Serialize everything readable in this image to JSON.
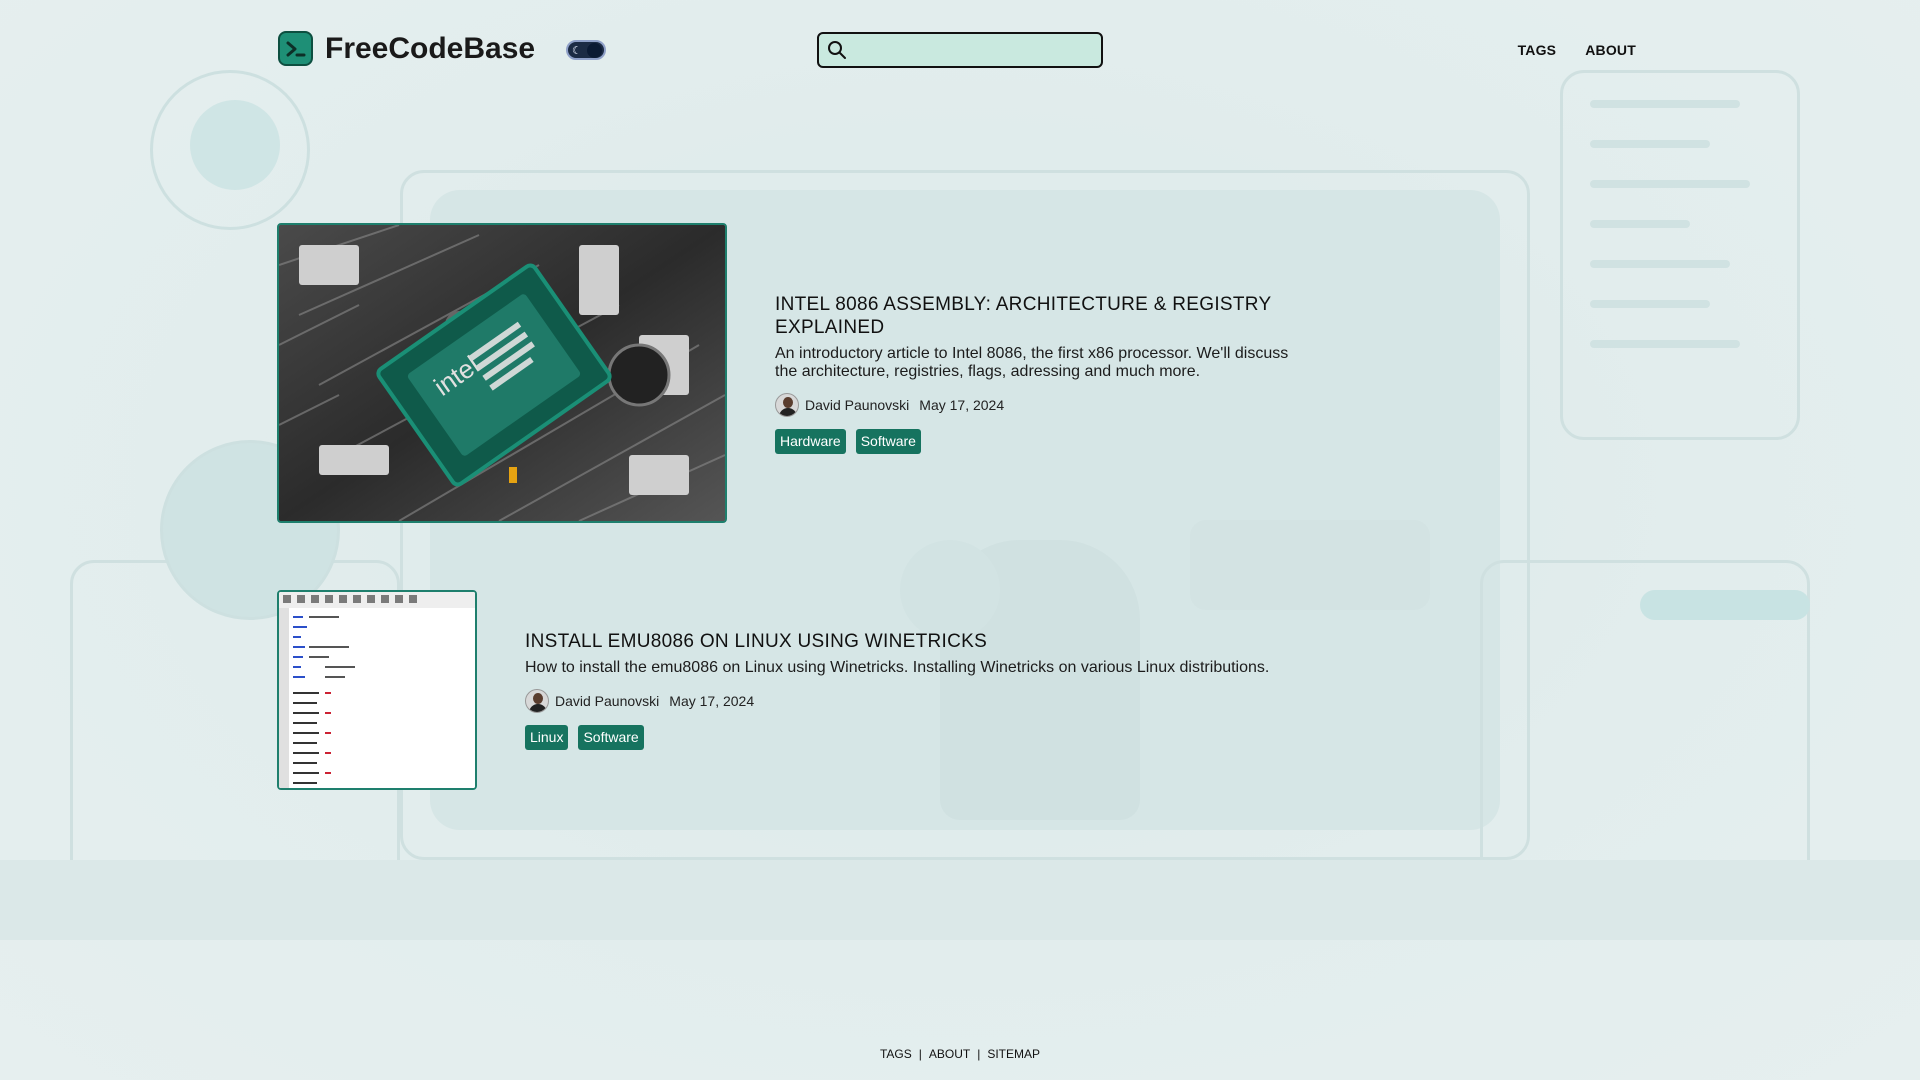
{
  "header": {
    "brand": "FreeCodeBase",
    "search_placeholder": "",
    "nav": [
      "TAGS",
      "ABOUT"
    ]
  },
  "posts": [
    {
      "title": "INTEL 8086 ASSEMBLY: ARCHITECTURE & REGISTRY EXPLAINED",
      "description": "An introductory article to Intel 8086, the first x86 processor. We'll discuss the architecture, registries, flags, adressing and much more.",
      "author": "David Paunovski",
      "date": "May 17, 2024",
      "tags": [
        "Hardware",
        "Software"
      ],
      "thumbnail_label": "intel"
    },
    {
      "title": "INSTALL EMU8086 ON LINUX USING WINETRICKS",
      "description": "How to install the emu8086 on Linux using Winetricks. Installing Winetricks on various Linux distributions.",
      "author": "David Paunovski",
      "date": "May 17, 2024",
      "tags": [
        "Linux",
        "Software"
      ]
    }
  ],
  "footer": {
    "links": [
      "TAGS",
      "ABOUT",
      "SITEMAP"
    ],
    "separator": "|"
  },
  "colors": {
    "accent": "#16735f",
    "background": "#e3eeee",
    "search_bg": "#c9e9df"
  },
  "icons": {
    "logo": "terminal-prompt-icon",
    "search": "magnifier-icon",
    "theme": "moon-icon"
  }
}
